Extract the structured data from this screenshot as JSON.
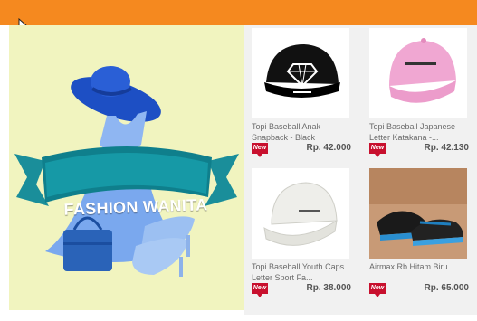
{
  "banner": {
    "text": "FASHION WANITA"
  },
  "products": [
    {
      "title": "Topi Baseball Anak Snapback - Black",
      "badge": "New",
      "price": "Rp. 42.000",
      "icon": "black-cap-image"
    },
    {
      "title": "Topi Baseball Japanese Letter Katakana -...",
      "badge": "New",
      "price": "Rp. 42.130",
      "icon": "pink-cap-image"
    },
    {
      "title": "Topi Baseball Youth Caps Letter Sport Fa...",
      "badge": "New",
      "price": "Rp. 38.000",
      "icon": "white-cap-image"
    },
    {
      "title": "Airmax Rb Hitam Biru",
      "badge": "New",
      "price": "Rp. 65.000",
      "icon": "sneakers-image"
    }
  ],
  "colors": {
    "topbar": "#f5891f",
    "banner_bg": "#f1f4bf",
    "badge": "#c8102e"
  }
}
